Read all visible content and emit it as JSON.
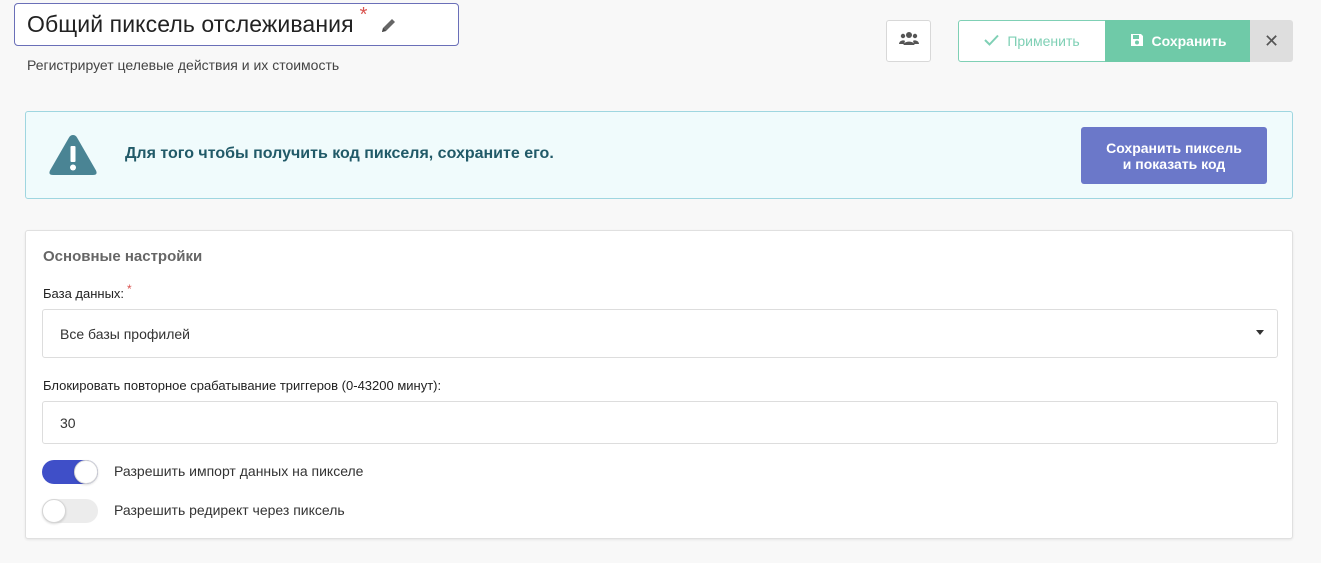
{
  "header": {
    "title": "Общий пиксель отслеживания",
    "title_required_mark": "*",
    "subtitle": "Регистрирует целевые действия и их стоимость"
  },
  "toolbar": {
    "apply_label": "Применить",
    "save_label": "Сохранить",
    "close_label": "✕"
  },
  "alert": {
    "message": "Для того чтобы получить код пикселя, сохраните его.",
    "button_line1": "Сохранить пиксель",
    "button_line2": "и показать код"
  },
  "settings": {
    "section_title": "Основные настройки",
    "database_label": "База данных:",
    "database_required_mark": "*",
    "database_value": "Все базы профилей",
    "block_label": "Блокировать повторное срабатывание триггеров (0-43200 минут):",
    "block_value": "30",
    "toggles": [
      {
        "label": "Разрешить импорт данных на пикселе",
        "on": true
      },
      {
        "label": "Разрешить редирект через пиксель",
        "on": false
      }
    ]
  },
  "colors": {
    "accent": "#3f4fc8",
    "save_green": "#6fcaa8",
    "alert_button": "#6b78c9",
    "alert_text": "#215a68",
    "required": "#d9534f"
  },
  "icons": {
    "edit": "pencil-icon",
    "users": "users-icon",
    "apply": "check-icon",
    "save": "floppy-disk-icon",
    "close": "close-icon",
    "warning": "warning-triangle-icon"
  }
}
